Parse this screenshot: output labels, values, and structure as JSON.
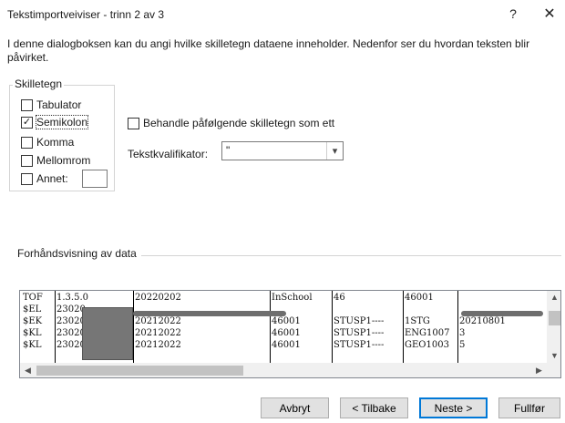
{
  "window": {
    "title": "Tekstimportveiviser - trinn 2 av 3",
    "help_glyph": "?",
    "close_glyph": "✕"
  },
  "description": "I denne dialogboksen kan du angi hvilke skilletegn dataene inneholder. Nedenfor ser du hvordan teksten blir påvirket.",
  "delimiters": {
    "legend": "Skilletegn",
    "tab": {
      "label": "Tabulator",
      "checked": false
    },
    "semicolon": {
      "label": "Semikolon",
      "checked": true
    },
    "comma": {
      "label": "Komma",
      "checked": false
    },
    "space": {
      "label": "Mellomrom",
      "checked": false
    },
    "other": {
      "label": "Annet:",
      "checked": false,
      "value": ""
    }
  },
  "treat_consecutive": {
    "label": "Behandle påfølgende skilletegn som ett",
    "checked": false
  },
  "qualifier": {
    "label": "Tekstkvalifikator:",
    "value": "\""
  },
  "preview": {
    "title": "Forhåndsvisning av data",
    "rows": [
      [
        "TOF",
        "1.3.5.0",
        "20220202",
        "InSchool",
        "46",
        "46001",
        ""
      ],
      [
        "$EL",
        "23020",
        "",
        "",
        "",
        "",
        ""
      ],
      [
        "$EK",
        "23020",
        "20212022",
        "46001",
        "STUSP1----",
        "1STG",
        "20210801"
      ],
      [
        "$KL",
        "23020",
        "20212022",
        "46001",
        "STUSP1----",
        "ENG1007",
        "3"
      ],
      [
        "$KL",
        "23020",
        "20212022",
        "46001",
        "STUSP1----",
        "GEO1003",
        "5"
      ]
    ]
  },
  "buttons": {
    "cancel": "Avbryt",
    "back": "< Tilbake",
    "next": "Neste >",
    "finish": "Fullfør"
  }
}
